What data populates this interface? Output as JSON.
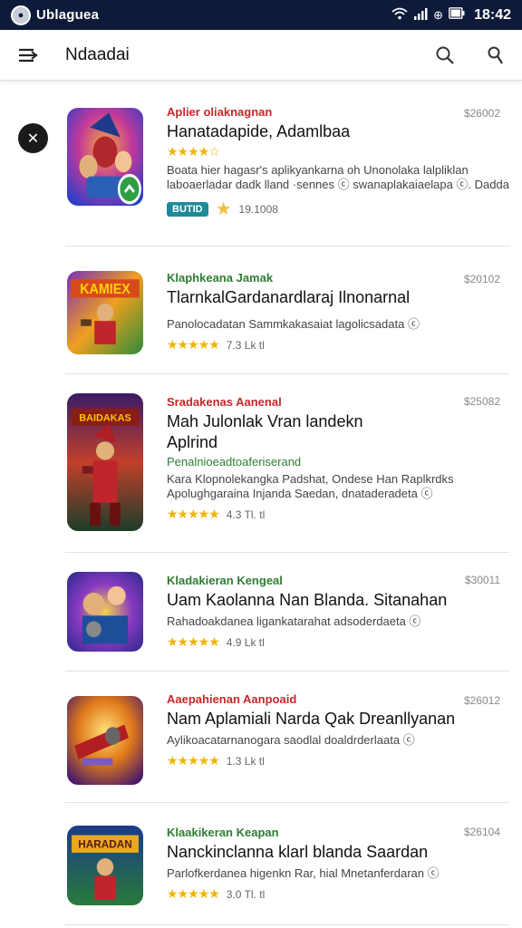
{
  "status_bar": {
    "title": "Ublaguea",
    "time": "18:42",
    "icons": [
      "wifi-icon",
      "signal-icon",
      "battery-icon"
    ]
  },
  "app_bar": {
    "title": "Ndaadai",
    "icons": [
      "menu-icon",
      "search-icon",
      "account-icon"
    ]
  },
  "apps": [
    {
      "developer": "Aplier oliaknagnan",
      "developer_color": "red",
      "name": "Hanatadapide, Adamlbaa",
      "price": "$26002",
      "description": "Boata hier hagasr's aplikyankarna oh Unonolaka lalpliklan laboaerladar dadk lland ·sennes ⓒ swanaplakaiaelapa ⓒ. Dadda",
      "badge": "BUTID",
      "rating_text": "19.1008"
    },
    {
      "developer": "Klaphkeana Jamak",
      "developer_color": "green",
      "name": "TlarnkalGardanardlaraj Ilnonarnal",
      "price": "$20102",
      "description": "Panolocadatan Sammkakasaiat lagolicsadata ⓒ",
      "stars": "★★★★★",
      "rating_text": "7.3 Lk tl"
    },
    {
      "developer": "Sradakenas Aanenal",
      "developer_color": "red",
      "name": "Mah Julonlak Vran landekn Aplrind",
      "price": "$25082",
      "subtitle": "Penalnioeadtoaferiserand",
      "description": "Kara Klopnolekangka Padshat, Ondese Han Raplkrdks Apolughgaraina Injanda Saedan, dnataderadeta ⓒ",
      "stars": "★★★★★",
      "rating_text": "4.3 Tl. tl"
    },
    {
      "developer": "Kladakieran Kengeal",
      "developer_color": "green",
      "name": "Uam Kaolanna Nan Blanda. Sitanahan",
      "price": "$30011",
      "description": "Rahadoakdanea ligankatarahat adsoderdaeta ⓒ",
      "stars": "★★★★★",
      "rating_text": "4.9 Lk tl"
    },
    {
      "developer": "Aaepahienan Aanpoaid",
      "developer_color": "red",
      "name": "Nam Aplamiali Narda Qak Dreanllyanan",
      "price": "$26012",
      "description": "Aylikoacatarnanogara saodlal doaldrderlaata ⓒ",
      "stars": "★★★★★",
      "rating_text": "1.3 Lk tl"
    },
    {
      "developer": "Klaakikeran Keapan",
      "developer_color": "green",
      "name": "Nanckinclanna klarl blanda Saardan",
      "price": "$26104",
      "description": "Parlofkerdanea higenkn Rar, hial Mnetanferdaran ⓒ",
      "stars": "★★★★★",
      "rating_text": "3.0 Tl. tl"
    }
  ],
  "colors": {
    "status_bar_bg": "#0d1a3a",
    "star": "#f0b400",
    "developer_red": "#c62828",
    "developer_green": "#2e7d32",
    "badge_bg": "#1e8a98"
  }
}
